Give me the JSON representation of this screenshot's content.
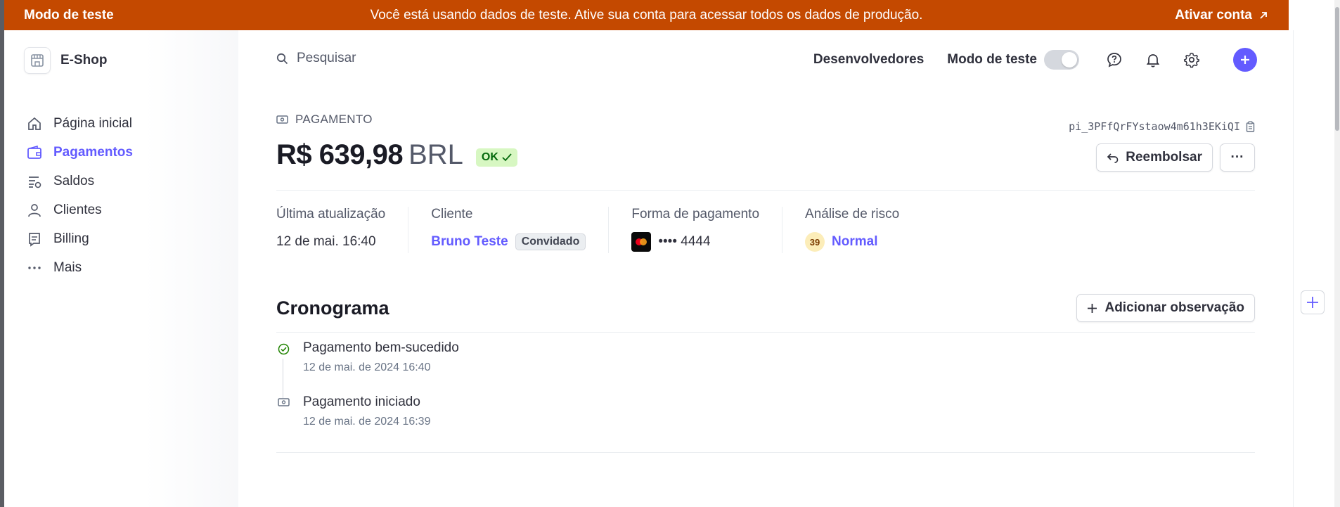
{
  "banner": {
    "mode_label": "Modo de teste",
    "message": "Você está usando dados de teste. Ative sua conta para acessar todos os dados de produção.",
    "activate_label": "Ativar conta"
  },
  "sidebar": {
    "brand": "E-Shop",
    "items": [
      {
        "label": "Página inicial",
        "icon": "home-icon",
        "active": false
      },
      {
        "label": "Pagamentos",
        "icon": "wallet-icon",
        "active": true
      },
      {
        "label": "Saldos",
        "icon": "balances-icon",
        "active": false
      },
      {
        "label": "Clientes",
        "icon": "person-icon",
        "active": false
      },
      {
        "label": "Billing",
        "icon": "billing-icon",
        "active": false
      },
      {
        "label": "Mais",
        "icon": "more-dots-icon",
        "active": false
      }
    ]
  },
  "header": {
    "search_placeholder": "Pesquisar",
    "developers": "Desenvolvedores",
    "test_mode": "Modo de teste"
  },
  "payment": {
    "type_label": "PAGAMENTO",
    "amount": "R$ 639,98",
    "currency": "BRL",
    "status": "OK",
    "id": "pi_3PFfQrFYstaow4m61h3EKiQI",
    "refund_label": "Reembolsar",
    "more_label": "···"
  },
  "summary": {
    "last_update_label": "Última atualização",
    "last_update_value": "12 de mai. 16:40",
    "customer_label": "Cliente",
    "customer_name": "Bruno Teste",
    "customer_badge": "Convidado",
    "method_label": "Forma de pagamento",
    "method_value": "•••• 4444",
    "risk_label": "Análise de risco",
    "risk_score": "39",
    "risk_level": "Normal"
  },
  "timeline": {
    "title": "Cronograma",
    "add_note_label": "Adicionar observação",
    "events": [
      {
        "title": "Pagamento bem-sucedido",
        "date": "12 de mai. de 2024 16:40",
        "icon": "check-circle-icon"
      },
      {
        "title": "Pagamento iniciado",
        "date": "12 de mai. de 2024 16:39",
        "icon": "payment-icon"
      }
    ]
  },
  "colors": {
    "banner": "#c44900",
    "accent": "#635bff",
    "success_bg": "#d7f7c2",
    "success_text": "#05690d"
  }
}
